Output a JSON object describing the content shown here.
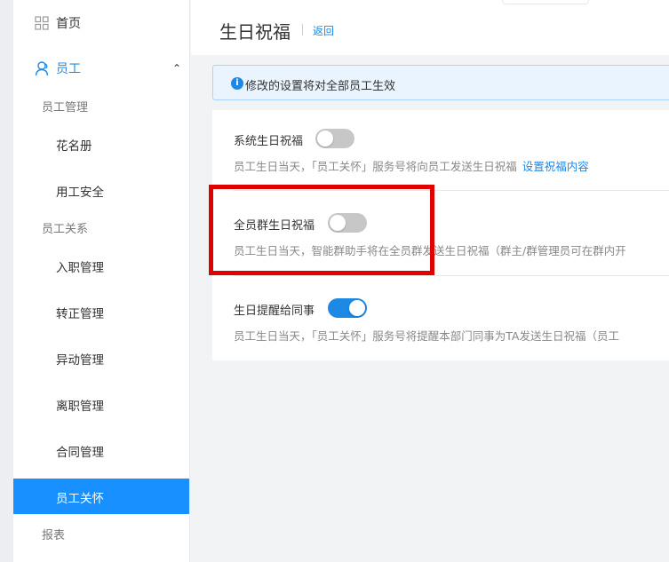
{
  "sidebar": {
    "home": "首页",
    "employee": "员工",
    "groups": {
      "management": "员工管理",
      "relations": "员工关系",
      "reports": "报表"
    },
    "items": {
      "roster": "花名册",
      "safety": "用工安全",
      "onboarding": "入职管理",
      "regularization": "转正管理",
      "transfer": "异动管理",
      "resignation": "离职管理",
      "contract": "合同管理",
      "care": "员工关怀"
    }
  },
  "header": {
    "title": "生日祝福",
    "back": "返回"
  },
  "notice": "修改的设置将对全部员工生效",
  "settings": [
    {
      "label": "系统生日祝福",
      "enabled": false,
      "description": "员工生日当天，「员工关怀」服务号将向员工发送生日祝福",
      "link": "设置祝福内容"
    },
    {
      "label": "全员群生日祝福",
      "enabled": false,
      "description": "员工生日当天，智能群助手将在全员群发送生日祝福（群主/群管理员可在群内开"
    },
    {
      "label": "生日提醒给同事",
      "enabled": true,
      "description": "员工生日当天，「员工关怀」服务号将提醒本部门同事为TA发送生日祝福（员工"
    }
  ],
  "colors": {
    "accent": "#1e88e5",
    "active_nav": "#1890ff",
    "highlight": "#e00000"
  }
}
